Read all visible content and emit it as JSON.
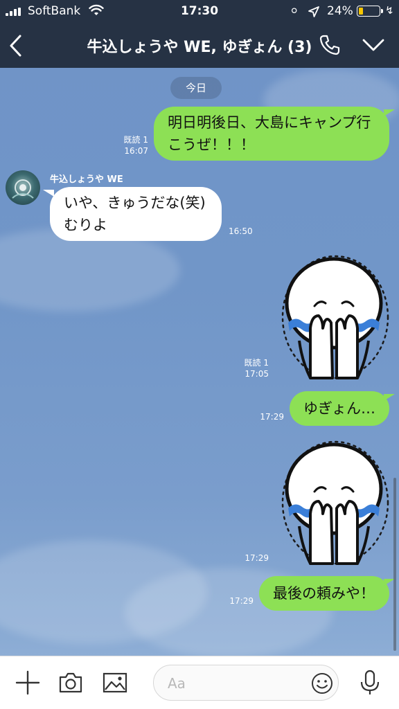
{
  "status_bar": {
    "carrier": "SoftBank",
    "time": "17:30",
    "battery_percent": "24%",
    "battery_level": 0.24
  },
  "nav": {
    "title": "牛込しょうや WE, ゆぎょん (3)",
    "icons": [
      "chevron-left-icon",
      "phone-icon",
      "chevron-down-icon"
    ]
  },
  "chat": {
    "date_label": "今日",
    "messages": [
      {
        "side": "out",
        "type": "text",
        "lines": [
          "明日明後日、大島にキャンプ行",
          "こうぜ！！！"
        ],
        "read": "既読 1",
        "time": "16:07"
      },
      {
        "side": "in",
        "type": "text",
        "sender": "牛込しょうや WE",
        "lines": [
          "いや、きゅうだな(笑)",
          "むりよ"
        ],
        "time": "16:50"
      },
      {
        "side": "out",
        "type": "sticker",
        "sticker": "crying-face-sticker",
        "read": "既読 1",
        "time": "17:05"
      },
      {
        "side": "out",
        "type": "text",
        "lines": [
          "ゆぎょん…"
        ],
        "time": "17:29"
      },
      {
        "side": "out",
        "type": "sticker",
        "sticker": "crying-face-sticker",
        "time": "17:29"
      },
      {
        "side": "out",
        "type": "text",
        "lines": [
          "最後の頼みや！"
        ],
        "time": "17:29"
      }
    ]
  },
  "input_bar": {
    "placeholder": "Aa",
    "icons": [
      "plus-icon",
      "camera-icon",
      "image-icon",
      "emoji-icon",
      "microphone-icon"
    ]
  },
  "colors": {
    "nav_bg": "#263244",
    "outgoing_bubble": "#8de055",
    "incoming_bubble": "#ffffff",
    "chat_background": "#7196c8",
    "battery_fill": "#f7c600"
  }
}
